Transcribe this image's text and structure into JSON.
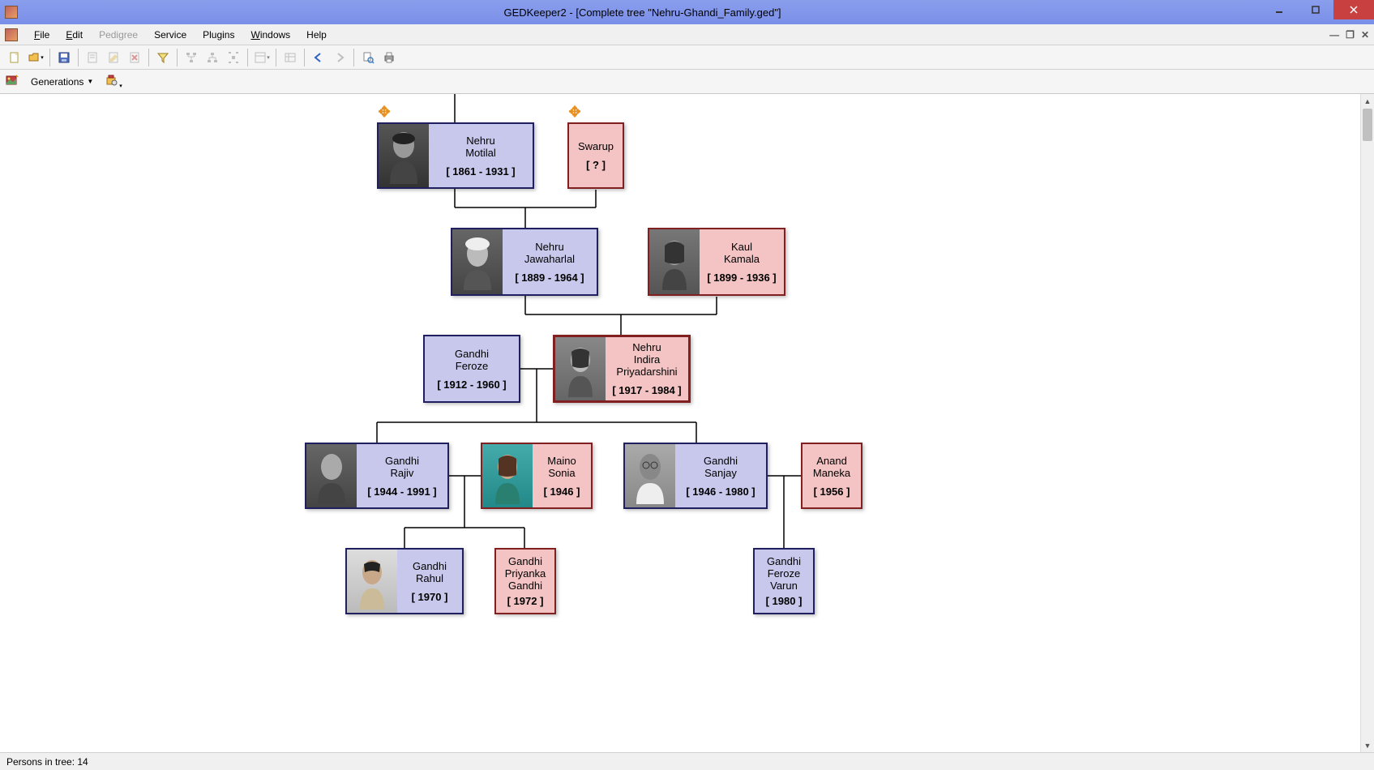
{
  "window": {
    "title": "GEDKeeper2 - [Complete tree \"Nehru-Ghandi_Family.ged\"]"
  },
  "menu": {
    "file": "File",
    "edit": "Edit",
    "pedigree": "Pedigree",
    "service": "Service",
    "plugins": "Plugins",
    "windows": "Windows",
    "help": "Help"
  },
  "toolbar2": {
    "generations": "Generations"
  },
  "persons": {
    "motilal": {
      "surname": "Nehru",
      "given": "Motilal",
      "years": "[ 1861 - 1931 ]"
    },
    "swarup": {
      "surname": "Swarup",
      "given": "",
      "years": "[ ? ]"
    },
    "jawaharlal": {
      "surname": "Nehru",
      "given": "Jawaharlal",
      "years": "[ 1889 - 1964 ]"
    },
    "kamala": {
      "surname": "Kaul",
      "given": "Kamala",
      "years": "[ 1899 - 1936 ]"
    },
    "feroze": {
      "surname": "Gandhi",
      "given": "Feroze",
      "years": "[ 1912 - 1960 ]"
    },
    "indira": {
      "surname": "Nehru",
      "given": "Indira",
      "given2": "Priyadarshini",
      "years": "[ 1917 - 1984 ]"
    },
    "rajiv": {
      "surname": "Gandhi",
      "given": "Rajiv",
      "years": "[ 1944 - 1991 ]"
    },
    "sonia": {
      "surname": "Maino",
      "given": "Sonia",
      "years": "[ 1946 ]"
    },
    "sanjay": {
      "surname": "Gandhi",
      "given": "Sanjay",
      "years": "[ 1946 - 1980 ]"
    },
    "maneka": {
      "surname": "Anand",
      "given": "Maneka",
      "years": "[ 1956 ]"
    },
    "rahul": {
      "surname": "Gandhi",
      "given": "Rahul",
      "years": "[ 1970 ]"
    },
    "priyanka": {
      "surname": "Gandhi",
      "given": "Priyanka",
      "given2": "Gandhi",
      "years": "[ 1972 ]"
    },
    "varun": {
      "surname": "Gandhi",
      "given": "Feroze",
      "given2": "Varun",
      "years": "[ 1980 ]"
    }
  },
  "status": {
    "persons_count": "Persons in tree: 14"
  }
}
